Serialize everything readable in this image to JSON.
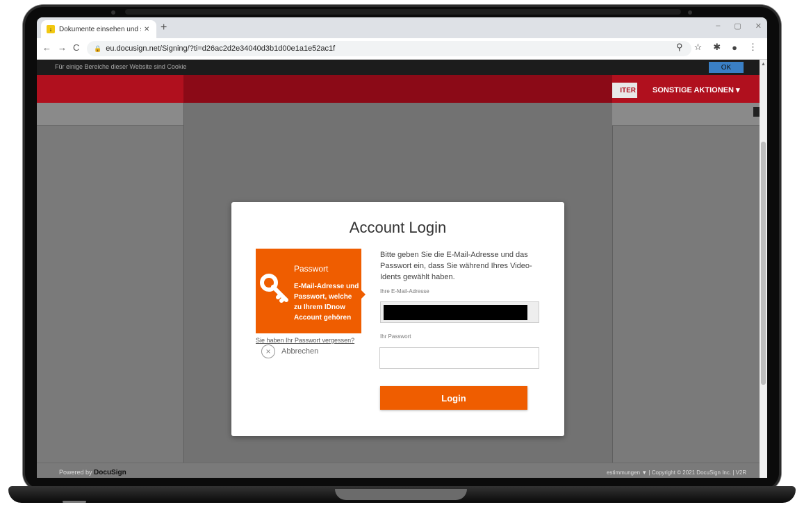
{
  "browser": {
    "tab_title": "Dokumente einsehen und signie",
    "tab_close": "✕",
    "new_tab": "+",
    "url": "eu.docusign.net/Signing/?ti=d26ac2d2e34040d3b1d00e1a1e52ac1f",
    "nav": {
      "back": "←",
      "forward": "→",
      "reload": "C"
    },
    "window_controls": {
      "minimize": "–",
      "restore": "▢",
      "close": "✕"
    }
  },
  "page": {
    "cookie_text": "Für einige Bereiche dieser Website sind Cookie",
    "ok_label": "OK",
    "weiter_label": "ITER",
    "more_actions_label": "SONSTIGE AKTIONEN ▾",
    "powered_by": "Powered by",
    "powered_brand": "DocuSign",
    "footer_right": "estimmungen ▼   |  Copyright © 2021 DocuSign Inc. | V2R"
  },
  "modal": {
    "title": "Account Login",
    "orange_title": "Passwort",
    "orange_text": "E-Mail-Adresse und Passwort, welche zu Ihrem IDnow Account gehören",
    "forgot_link": "Sie haben Ihr Passwort vergessen?",
    "cancel_label": "Abbrechen",
    "instruction": "Bitte geben Sie die E-Mail-Adresse und das Passwort ein, dass Sie während Ihres Video-Idents gewählt haben.",
    "email_label": "Ihre E-Mail-Adresse",
    "password_label": "Ihr Passwort",
    "password_value": "",
    "login_label": "Login"
  },
  "colors": {
    "accent_orange": "#ef5d00",
    "docusign_red": "#b0101e",
    "ok_blue": "#3a7fc5"
  }
}
